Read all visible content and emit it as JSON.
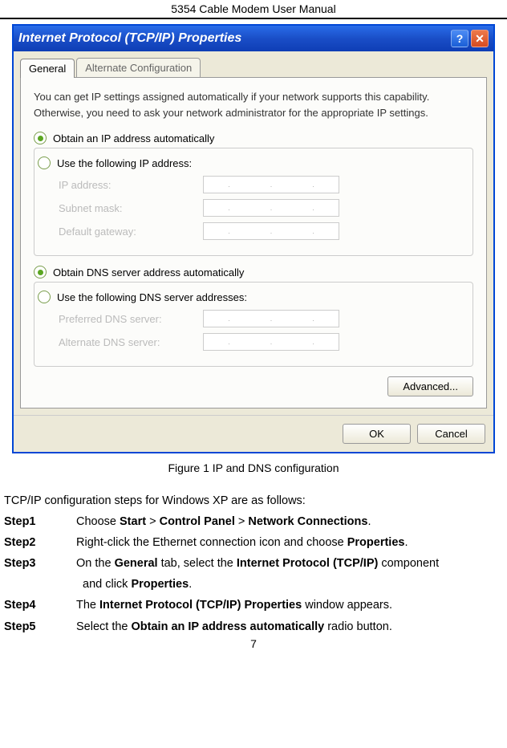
{
  "doc_title": "5354 Cable Modem User Manual",
  "dialog": {
    "title": "Internet Protocol (TCP/IP) Properties",
    "help_glyph": "?",
    "close_glyph": "✕",
    "tabs": {
      "general": "General",
      "alt": "Alternate Configuration"
    },
    "intro": "You can get IP settings assigned automatically if your network supports this capability. Otherwise, you need to ask your network administrator for the appropriate IP settings.",
    "radio_ip_auto": "Obtain an IP address automatically",
    "radio_ip_manual": "Use the following IP address:",
    "labels": {
      "ip": "IP address:",
      "subnet": "Subnet mask:",
      "gateway": "Default gateway:",
      "pref_dns": "Preferred DNS server:",
      "alt_dns": "Alternate DNS server:"
    },
    "radio_dns_auto": "Obtain DNS server address automatically",
    "radio_dns_manual": "Use the following DNS server addresses:",
    "advanced": "Advanced...",
    "ok": "OK",
    "cancel": "Cancel"
  },
  "caption": "Figure 1 IP and DNS configuration",
  "intro_steps": "TCP/IP configuration steps for Windows XP are as follows:",
  "steps": {
    "s1": "Step1",
    "s2": "Step2",
    "s3": "Step3",
    "s4": "Step4",
    "s5": "Step5",
    "b1a": "Choose ",
    "b1_start": "Start",
    "b1_gt1": " > ",
    "b1_cp": "Control Panel",
    "b1_gt2": " > ",
    "b1_nc": "Network Connections",
    "b1_end": ".",
    "b2a": "Right-click the Ethernet connection icon and choose ",
    "b2_prop": "Properties",
    "b2_end": ".",
    "b3a": "On the ",
    "b3_gen": "General",
    "b3b": " tab, select the ",
    "b3_ip": "Internet Protocol (TCP/IP)",
    "b3c": " component",
    "b3d": " and click ",
    "b3_prop": "Properties",
    "b3_end": ".",
    "b4a": "The ",
    "b4_win": "Internet Protocol (TCP/IP) Properties",
    "b4b": " window appears.",
    "b5a": "Select the ",
    "b5_obt": "Obtain an IP address automatically",
    "b5b": " radio button."
  },
  "page_number": "7"
}
